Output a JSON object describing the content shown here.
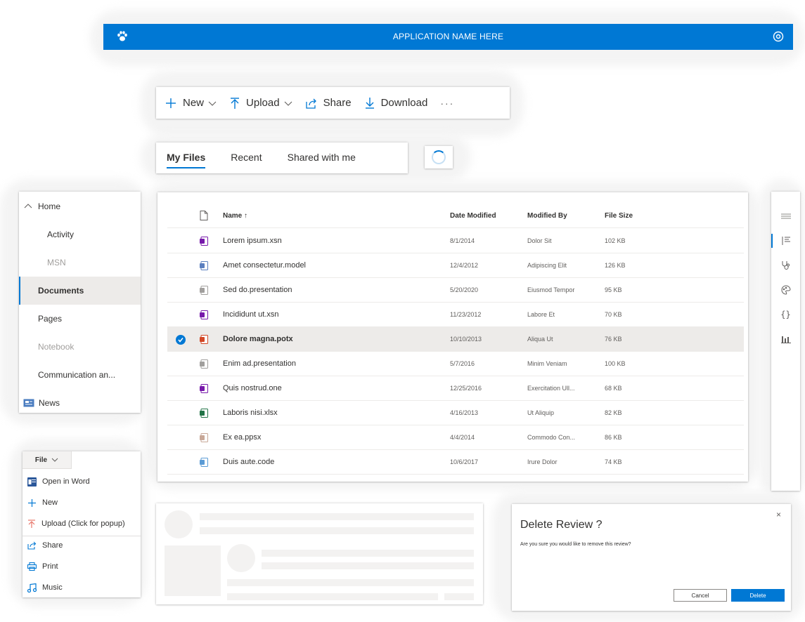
{
  "app": {
    "title": "APPLICATION NAME HERE",
    "brand_color": "#0078d4"
  },
  "commands": [
    {
      "label": "New",
      "icon": "plus-icon",
      "dropdown": true
    },
    {
      "label": "Upload",
      "icon": "upload-icon",
      "dropdown": true
    },
    {
      "label": "Share",
      "icon": "share-icon",
      "dropdown": false
    },
    {
      "label": "Download",
      "icon": "download-icon",
      "dropdown": false
    }
  ],
  "more_label": "···",
  "tabs": [
    "My Files",
    "Recent",
    "Shared with me"
  ],
  "nav": [
    {
      "label": "Home",
      "state": "expanded"
    },
    {
      "label": "Activity",
      "state": "child"
    },
    {
      "label": "MSN",
      "state": "disabled-child"
    },
    {
      "label": "Documents",
      "state": "selected"
    },
    {
      "label": "Pages",
      "state": "normal"
    },
    {
      "label": "Notebook",
      "state": "disabled"
    },
    {
      "label": "Communication an...",
      "state": "normal"
    },
    {
      "label": "News",
      "state": "icon"
    }
  ],
  "table": {
    "columns": {
      "name": "Name ↑",
      "date": "Date Modified",
      "by": "Modified By",
      "size": "File Size"
    },
    "rows": [
      {
        "name": "Lorem ipsum.xsn",
        "date": "8/1/2014",
        "by": "Dolor Sit",
        "size": "102 KB",
        "icon": "onenote-icon",
        "color": "#7719aa"
      },
      {
        "name": "Amet consectetur.model",
        "date": "12/4/2012",
        "by": "Adipiscing Elit",
        "size": "126 KB",
        "icon": "model-file-icon",
        "color": "#5b7fbf"
      },
      {
        "name": "Sed do.presentation",
        "date": "5/20/2020",
        "by": "Eiusmod Tempor",
        "size": "95 KB",
        "icon": "presentation-file-icon",
        "color": "#a19f9d"
      },
      {
        "name": "Incididunt ut.xsn",
        "date": "11/23/2012",
        "by": "Labore Et",
        "size": "70 KB",
        "icon": "onenote-icon",
        "color": "#7719aa"
      },
      {
        "name": "Dolore magna.potx",
        "date": "10/10/2013",
        "by": "Aliqua Ut",
        "size": "76 KB",
        "icon": "powerpoint-icon",
        "color": "#d24726",
        "selected": true
      },
      {
        "name": "Enim ad.presentation",
        "date": "5/7/2016",
        "by": "Minim Veniam",
        "size": "100 KB",
        "icon": "presentation-file-icon",
        "color": "#a19f9d"
      },
      {
        "name": "Quis nostrud.one",
        "date": "12/25/2016",
        "by": "Exercitation Ull...",
        "size": "68 KB",
        "icon": "onenote-icon",
        "color": "#7719aa"
      },
      {
        "name": "Laboris nisi.xlsx",
        "date": "4/16/2013",
        "by": "Ut Aliquip",
        "size": "82 KB",
        "icon": "excel-icon",
        "color": "#217346"
      },
      {
        "name": "Ex ea.ppsx",
        "date": "4/4/2014",
        "by": "Commodo Con...",
        "size": "86 KB",
        "icon": "slideshow-file-icon",
        "color": "#c8a898"
      },
      {
        "name": "Duis aute.code",
        "date": "10/6/2017",
        "by": "Irure Dolor",
        "size": "74 KB",
        "icon": "code-file-icon",
        "color": "#5b9bd5"
      }
    ]
  },
  "file_menu": {
    "button": "File",
    "items": [
      "Open in Word",
      "New",
      "Upload (Click for popup)",
      "Share",
      "Print",
      "Music"
    ]
  },
  "dialog": {
    "title": "Delete Review ?",
    "text": "Are you sure you would like to remove this review?",
    "cancel": "Cancel",
    "confirm": "Delete",
    "close": "×"
  }
}
